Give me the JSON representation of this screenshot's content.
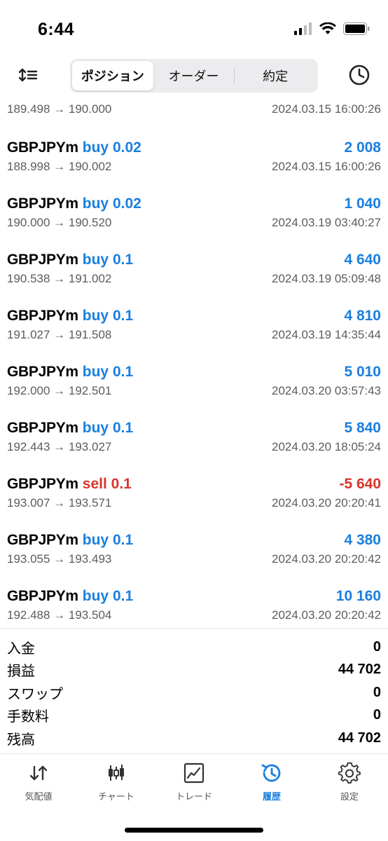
{
  "status_bar": {
    "time": "6:44"
  },
  "header": {
    "tabs": [
      {
        "label": "ポジション",
        "active": true
      },
      {
        "label": "オーダー",
        "active": false
      },
      {
        "label": "約定",
        "active": false
      }
    ]
  },
  "partial": {
    "prices": "189.498 → 190.000",
    "time": "2024.03.15 16:00:26"
  },
  "deals": [
    {
      "symbol": "GBPJPYm",
      "type": "buy 0.02",
      "side": "buy",
      "profit": "2 008",
      "prices": "188.998 → 190.002",
      "time": "2024.03.15 16:00:26"
    },
    {
      "symbol": "GBPJPYm",
      "type": "buy 0.02",
      "side": "buy",
      "profit": "1 040",
      "prices": "190.000 → 190.520",
      "time": "2024.03.19 03:40:27"
    },
    {
      "symbol": "GBPJPYm",
      "type": "buy 0.1",
      "side": "buy",
      "profit": "4 640",
      "prices": "190.538 → 191.002",
      "time": "2024.03.19 05:09:48"
    },
    {
      "symbol": "GBPJPYm",
      "type": "buy 0.1",
      "side": "buy",
      "profit": "4 810",
      "prices": "191.027 → 191.508",
      "time": "2024.03.19 14:35:44"
    },
    {
      "symbol": "GBPJPYm",
      "type": "buy 0.1",
      "side": "buy",
      "profit": "5 010",
      "prices": "192.000 → 192.501",
      "time": "2024.03.20 03:57:43"
    },
    {
      "symbol": "GBPJPYm",
      "type": "buy 0.1",
      "side": "buy",
      "profit": "5 840",
      "prices": "192.443 → 193.027",
      "time": "2024.03.20 18:05:24"
    },
    {
      "symbol": "GBPJPYm",
      "type": "sell 0.1",
      "side": "sell",
      "profit": "-5 640",
      "prices": "193.007 → 193.571",
      "time": "2024.03.20 20:20:41"
    },
    {
      "symbol": "GBPJPYm",
      "type": "buy 0.1",
      "side": "buy",
      "profit": "4 380",
      "prices": "193.055 → 193.493",
      "time": "2024.03.20 20:20:42"
    },
    {
      "symbol": "GBPJPYm",
      "type": "buy 0.1",
      "side": "buy",
      "profit": "10 160",
      "prices": "192.488 → 193.504",
      "time": "2024.03.20 20:20:42"
    }
  ],
  "summary": [
    {
      "label": "入金",
      "value": "0"
    },
    {
      "label": "損益",
      "value": "44 702"
    },
    {
      "label": "スワップ",
      "value": "0"
    },
    {
      "label": "手数料",
      "value": "0"
    },
    {
      "label": "残高",
      "value": "44 702"
    }
  ],
  "tabbar": [
    {
      "label": "気配値",
      "icon": "quotes-icon",
      "active": false
    },
    {
      "label": "チャート",
      "icon": "chart-icon",
      "active": false
    },
    {
      "label": "トレード",
      "icon": "trade-icon",
      "active": false
    },
    {
      "label": "履歴",
      "icon": "history-icon",
      "active": true
    },
    {
      "label": "設定",
      "icon": "settings-icon",
      "active": false
    }
  ],
  "colors": {
    "buy": "#1a7fe0",
    "sell": "#d8352b",
    "accent": "#1a7fe0"
  }
}
